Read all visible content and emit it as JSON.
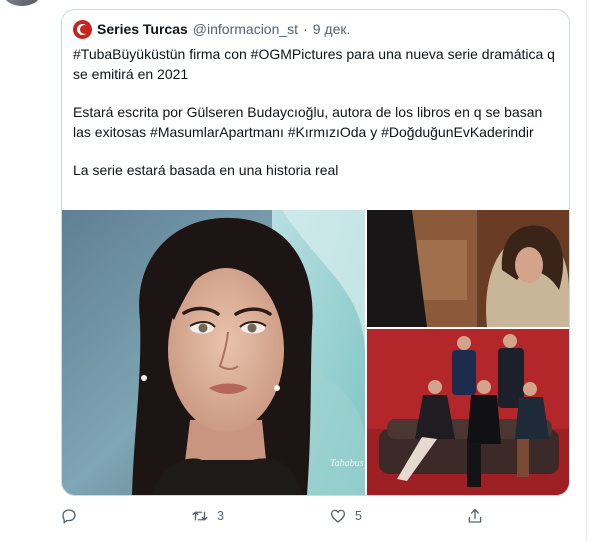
{
  "quoted_tweet": {
    "author_name": "Series Turcas",
    "author_handle": "@informacion_st",
    "separator": "·",
    "date": "9 дек.",
    "paragraphs": [
      "#TubaBüyüküstün firma con #OGMPictures para una nueva serie dramática q se emitirá en 2021",
      "Estará escrita por Gülseren Budaycıoğlu, autora de los libros en q se basan las exitosas #MasumlarApartmanı #KırmızıOda y #DoğduğunEvKaderindir",
      "La serie estará basada en una historia real"
    ],
    "media": {
      "watermark": "Tababus"
    }
  },
  "actions": {
    "reply": {
      "icon": "reply-icon",
      "count": ""
    },
    "retweet": {
      "icon": "retweet-icon",
      "count": "3"
    },
    "like": {
      "icon": "heart-icon",
      "count": "5"
    },
    "share": {
      "icon": "share-icon",
      "count": ""
    }
  },
  "colors": {
    "text": "#0f1419",
    "secondary": "#536471",
    "border": "#cfd9de",
    "avatar_red": "#c3261e",
    "photo_red": "#b3262a"
  }
}
